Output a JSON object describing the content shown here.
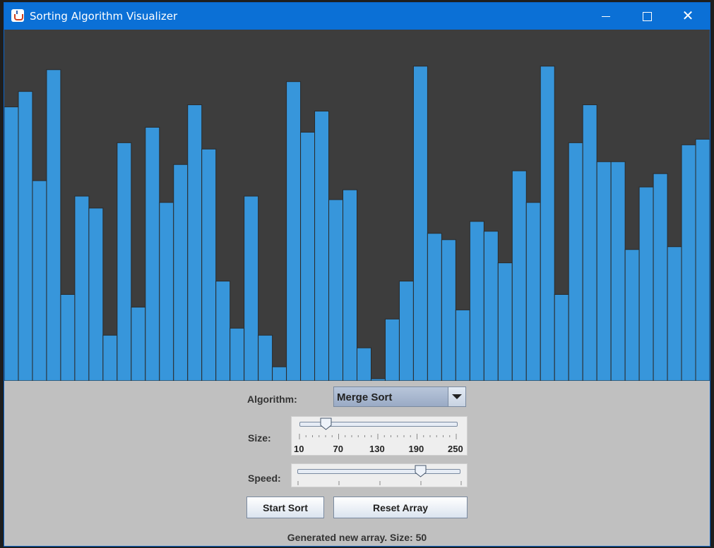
{
  "window": {
    "title": "Sorting Algorithm Visualizer"
  },
  "titlebar_buttons": {
    "minimize": "minimize-icon",
    "maximize": "maximize-icon",
    "close": "close-icon"
  },
  "colors": {
    "bar": "#3796db",
    "bar_border": "#2a2a2a",
    "canvas_bg": "#3d3d3d",
    "panel_bg": "#c0c0c0",
    "titlebar": "#0b70d6"
  },
  "chart_data": {
    "type": "bar",
    "values": [
      390,
      412,
      285,
      443,
      123,
      263,
      246,
      65,
      339,
      105,
      361,
      254,
      308,
      393,
      330,
      142,
      75,
      263,
      65,
      20,
      426,
      354,
      384,
      258,
      272,
      47,
      3,
      88,
      142,
      448,
      210,
      201,
      101,
      227,
      213,
      168,
      299,
      254,
      448,
      123,
      339,
      393,
      312,
      312,
      187,
      276,
      295,
      191,
      336,
      344
    ],
    "ylim": [
      0,
      500
    ]
  },
  "controls": {
    "algorithm_label": "Algorithm:",
    "algorithm_value": "Merge Sort",
    "size_label": "Size:",
    "size_value": 50,
    "size_min": 10,
    "size_max": 250,
    "size_ticks": [
      "10",
      "70",
      "130",
      "190",
      "250"
    ],
    "speed_label": "Speed:",
    "speed_fraction": 0.76,
    "start_button": "Start Sort",
    "reset_button": "Reset Array",
    "status": "Generated new array. Size: 50"
  }
}
